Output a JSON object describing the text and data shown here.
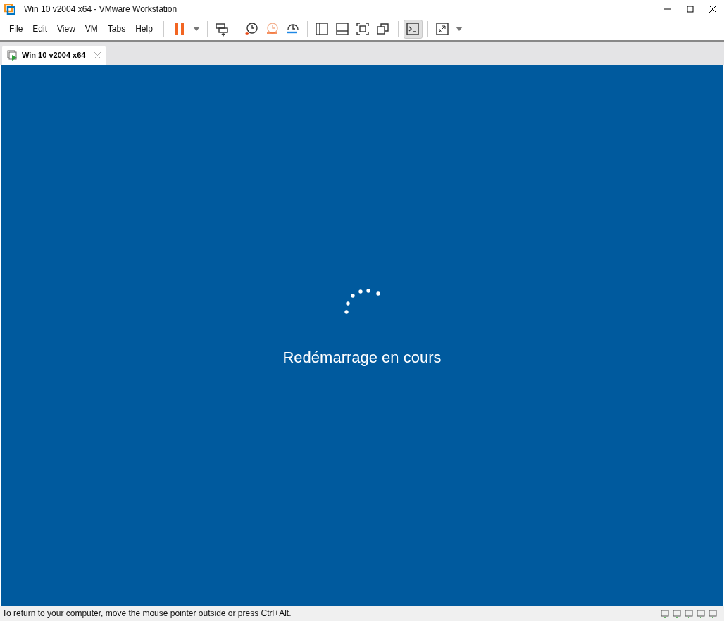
{
  "window": {
    "title": "Win 10 v2004 x64 - VMware Workstation"
  },
  "menu": [
    "File",
    "Edit",
    "View",
    "VM",
    "Tabs",
    "Help"
  ],
  "toolbar": [
    {
      "kind": "pause",
      "pressed": false
    },
    {
      "kind": "caret",
      "pressed": false
    },
    {
      "kind": "sep"
    },
    {
      "kind": "send-keys",
      "pressed": false
    },
    {
      "kind": "sep"
    },
    {
      "kind": "snapshot",
      "pressed": false
    },
    {
      "kind": "revert",
      "pressed": false
    },
    {
      "kind": "manage",
      "pressed": false
    },
    {
      "kind": "sep"
    },
    {
      "kind": "library",
      "pressed": false
    },
    {
      "kind": "thumbnail",
      "pressed": false
    },
    {
      "kind": "fullscreen",
      "pressed": false
    },
    {
      "kind": "unity",
      "pressed": false
    },
    {
      "kind": "sep"
    },
    {
      "kind": "console",
      "pressed": true
    },
    {
      "kind": "sep"
    },
    {
      "kind": "stretch",
      "pressed": false
    },
    {
      "kind": "caret",
      "pressed": false
    }
  ],
  "tabs": [
    {
      "label": "Win 10 v2004 x64",
      "selected": true
    }
  ],
  "vm_screen": {
    "message": "Redémarrage en cours"
  },
  "status_bar": {
    "text": "To return to your computer, move the mouse pointer outside or press Ctrl+Alt."
  }
}
